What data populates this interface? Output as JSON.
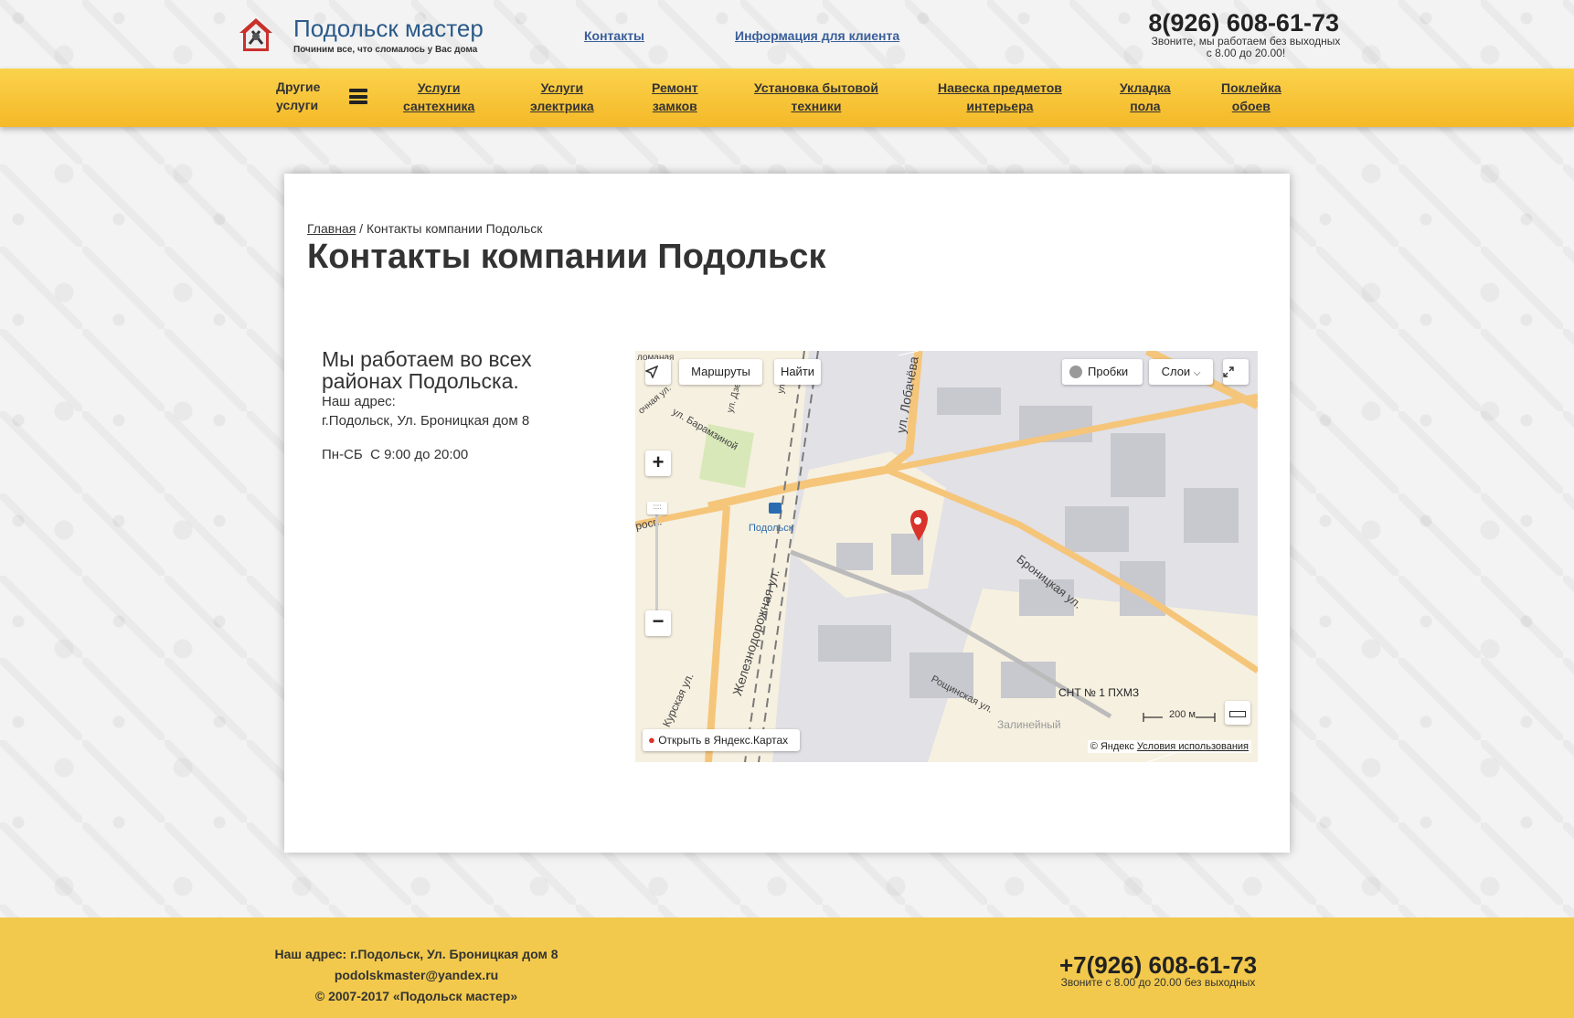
{
  "header": {
    "brand_name": "Подольск мастер",
    "tagline": "Починим все, что сломалось у Вас дома",
    "links": [
      {
        "label": "Контакты"
      },
      {
        "label": "Информация для клиента"
      }
    ],
    "phone": "8(926) 608-61-73",
    "hours_line1": "Звоните, мы работаем без выходных",
    "hours_line2": "с 8.00 до 20.00!"
  },
  "nav": {
    "other_line1": "Другие",
    "other_line2": "услуги",
    "items": [
      {
        "line1": "Услуги",
        "line2": "сантехника"
      },
      {
        "line1": "Услуги",
        "line2": "электрика"
      },
      {
        "line1": "Ремонт",
        "line2": "замков"
      },
      {
        "line1": "Установка бытовой",
        "line2": "техники"
      },
      {
        "line1": "Навеска предметов",
        "line2": "интерьера"
      },
      {
        "line1": "Укладка",
        "line2": "пола"
      },
      {
        "line1": "Поклейка",
        "line2": "обоев"
      }
    ]
  },
  "breadcrumb": {
    "home": "Главная",
    "separator": " / ",
    "current": "Контакты компании Подольск"
  },
  "page_title": "Контакты компании Подольск",
  "contact": {
    "lead": "Мы работаем во всех районах Подольска.",
    "address_label": "Наш адрес:",
    "address": "г.Подольск, Ул. Броницкая дом 8",
    "hours": "Пн-СБ  С 9:00 до 20:00"
  },
  "map": {
    "routes_button": "Маршруты",
    "find_button": "Найти",
    "traffic_button": "Пробки",
    "layers_button": "Слои",
    "open_link": "Открыть в Яндекс.Картах",
    "scale": "200 м",
    "copyright": "© Яндекс",
    "terms": "Условия использования",
    "labels": {
      "station": "Подольск",
      "street_lobacheva": "ул. Лобачёва",
      "street_bronnitskaya": "Броницкая ул.",
      "street_zheleznodorozhnaya": "Железнодорожная ул.",
      "street_kurskaya": "Курская ул.",
      "street_roshchinskaya": "Рощинская ул.",
      "street_baramzinoy": "ул. Барамзиной",
      "snt": "СНТ № 1 ПХМЗ",
      "district": "Залинейный",
      "prosp": "росп.",
      "street_dzerzh": "ул. Дзерж",
      "street_lomanaya": "ломаная",
      "street_fragment": "очная ул.",
      "street_ul": "ул. Р"
    },
    "colors": {
      "industrial": "#e1e1e6",
      "residential": "#f6f0e0",
      "major_road": "#f5c57a",
      "rail": "#7a7a7a",
      "park": "#d8e8b8",
      "marker": "#d9342b"
    }
  },
  "footer": {
    "address": "Наш адрес: г.Подольск, Ул. Броницкая дом 8",
    "email": "podolskmaster@yandex.ru",
    "copyright": "© 2007-2017 «Подольск мастер»",
    "phone": "+7(926) 608-61-73",
    "hours": "Звоните с 8.00 до 20.00 без выходных"
  }
}
